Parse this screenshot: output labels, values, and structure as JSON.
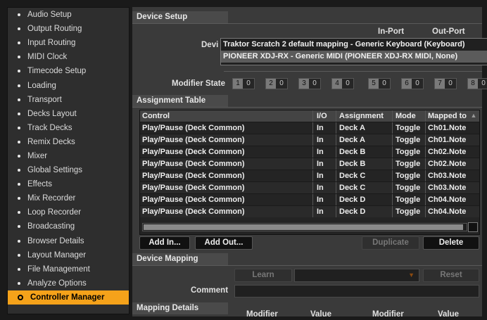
{
  "sidebar": {
    "items": [
      {
        "label": "Audio Setup"
      },
      {
        "label": "Output Routing"
      },
      {
        "label": "Input Routing"
      },
      {
        "label": "MIDI Clock"
      },
      {
        "label": "Timecode Setup"
      },
      {
        "label": "Loading"
      },
      {
        "label": "Transport"
      },
      {
        "label": "Decks Layout"
      },
      {
        "label": "Track Decks"
      },
      {
        "label": "Remix Decks"
      },
      {
        "label": "Mixer"
      },
      {
        "label": "Global Settings"
      },
      {
        "label": "Effects"
      },
      {
        "label": "Mix Recorder"
      },
      {
        "label": "Loop Recorder"
      },
      {
        "label": "Broadcasting"
      },
      {
        "label": "Browser Details"
      },
      {
        "label": "Layout Manager"
      },
      {
        "label": "File Management"
      },
      {
        "label": "Analyze Options"
      },
      {
        "label": "Controller Manager"
      }
    ],
    "active_index": 20,
    "accent_color": "#f5a21a"
  },
  "device_setup": {
    "header": "Device Setup",
    "device_label": "Devi",
    "in_port_label": "In-Port",
    "out_port_label": "Out-Port",
    "dropdown": [
      {
        "label": "Traktor Scratch 2 default mapping - Generic Keyboard (Keyboard)"
      },
      {
        "label": "PIONEER XDJ-RX - Generic MIDI (PIONEER XDJ-RX MIDI, None)"
      }
    ],
    "modifier_state_label": "Modifier State",
    "modifiers": [
      {
        "key": "1",
        "value": "0"
      },
      {
        "key": "2",
        "value": "0"
      },
      {
        "key": "3",
        "value": "0"
      },
      {
        "key": "4",
        "value": "0"
      },
      {
        "key": "5",
        "value": "0"
      },
      {
        "key": "6",
        "value": "0"
      },
      {
        "key": "7",
        "value": "0"
      },
      {
        "key": "8",
        "value": "0"
      }
    ]
  },
  "assignment_table": {
    "header": "Assignment Table",
    "columns": [
      "Control",
      "I/O",
      "Assignment",
      "Mode",
      "Mapped to"
    ],
    "rows": [
      {
        "control": "Play/Pause (Deck Common)",
        "io": "In",
        "assignment": "Deck A",
        "mode": "Toggle",
        "mapped": "Ch01.Note"
      },
      {
        "control": "Play/Pause (Deck Common)",
        "io": "In",
        "assignment": "Deck A",
        "mode": "Toggle",
        "mapped": "Ch01.Note"
      },
      {
        "control": "Play/Pause (Deck Common)",
        "io": "In",
        "assignment": "Deck B",
        "mode": "Toggle",
        "mapped": "Ch02.Note"
      },
      {
        "control": "Play/Pause (Deck Common)",
        "io": "In",
        "assignment": "Deck B",
        "mode": "Toggle",
        "mapped": "Ch02.Note"
      },
      {
        "control": "Play/Pause (Deck Common)",
        "io": "In",
        "assignment": "Deck C",
        "mode": "Toggle",
        "mapped": "Ch03.Note"
      },
      {
        "control": "Play/Pause (Deck Common)",
        "io": "In",
        "assignment": "Deck C",
        "mode": "Toggle",
        "mapped": "Ch03.Note"
      },
      {
        "control": "Play/Pause (Deck Common)",
        "io": "In",
        "assignment": "Deck D",
        "mode": "Toggle",
        "mapped": "Ch04.Note"
      },
      {
        "control": "Play/Pause (Deck Common)",
        "io": "In",
        "assignment": "Deck D",
        "mode": "Toggle",
        "mapped": "Ch04.Note"
      }
    ],
    "add_in_label": "Add In...",
    "add_out_label": "Add Out...",
    "duplicate_label": "Duplicate",
    "delete_label": "Delete"
  },
  "device_mapping": {
    "header": "Device Mapping",
    "learn_label": "Learn",
    "reset_label": "Reset",
    "comment_label": "Comment"
  },
  "mapping_details": {
    "header": "Mapping Details",
    "col_modifier_1": "Modifier",
    "col_value_1": "Value",
    "col_modifier_2": "Modifier",
    "col_value_2": "Value"
  }
}
